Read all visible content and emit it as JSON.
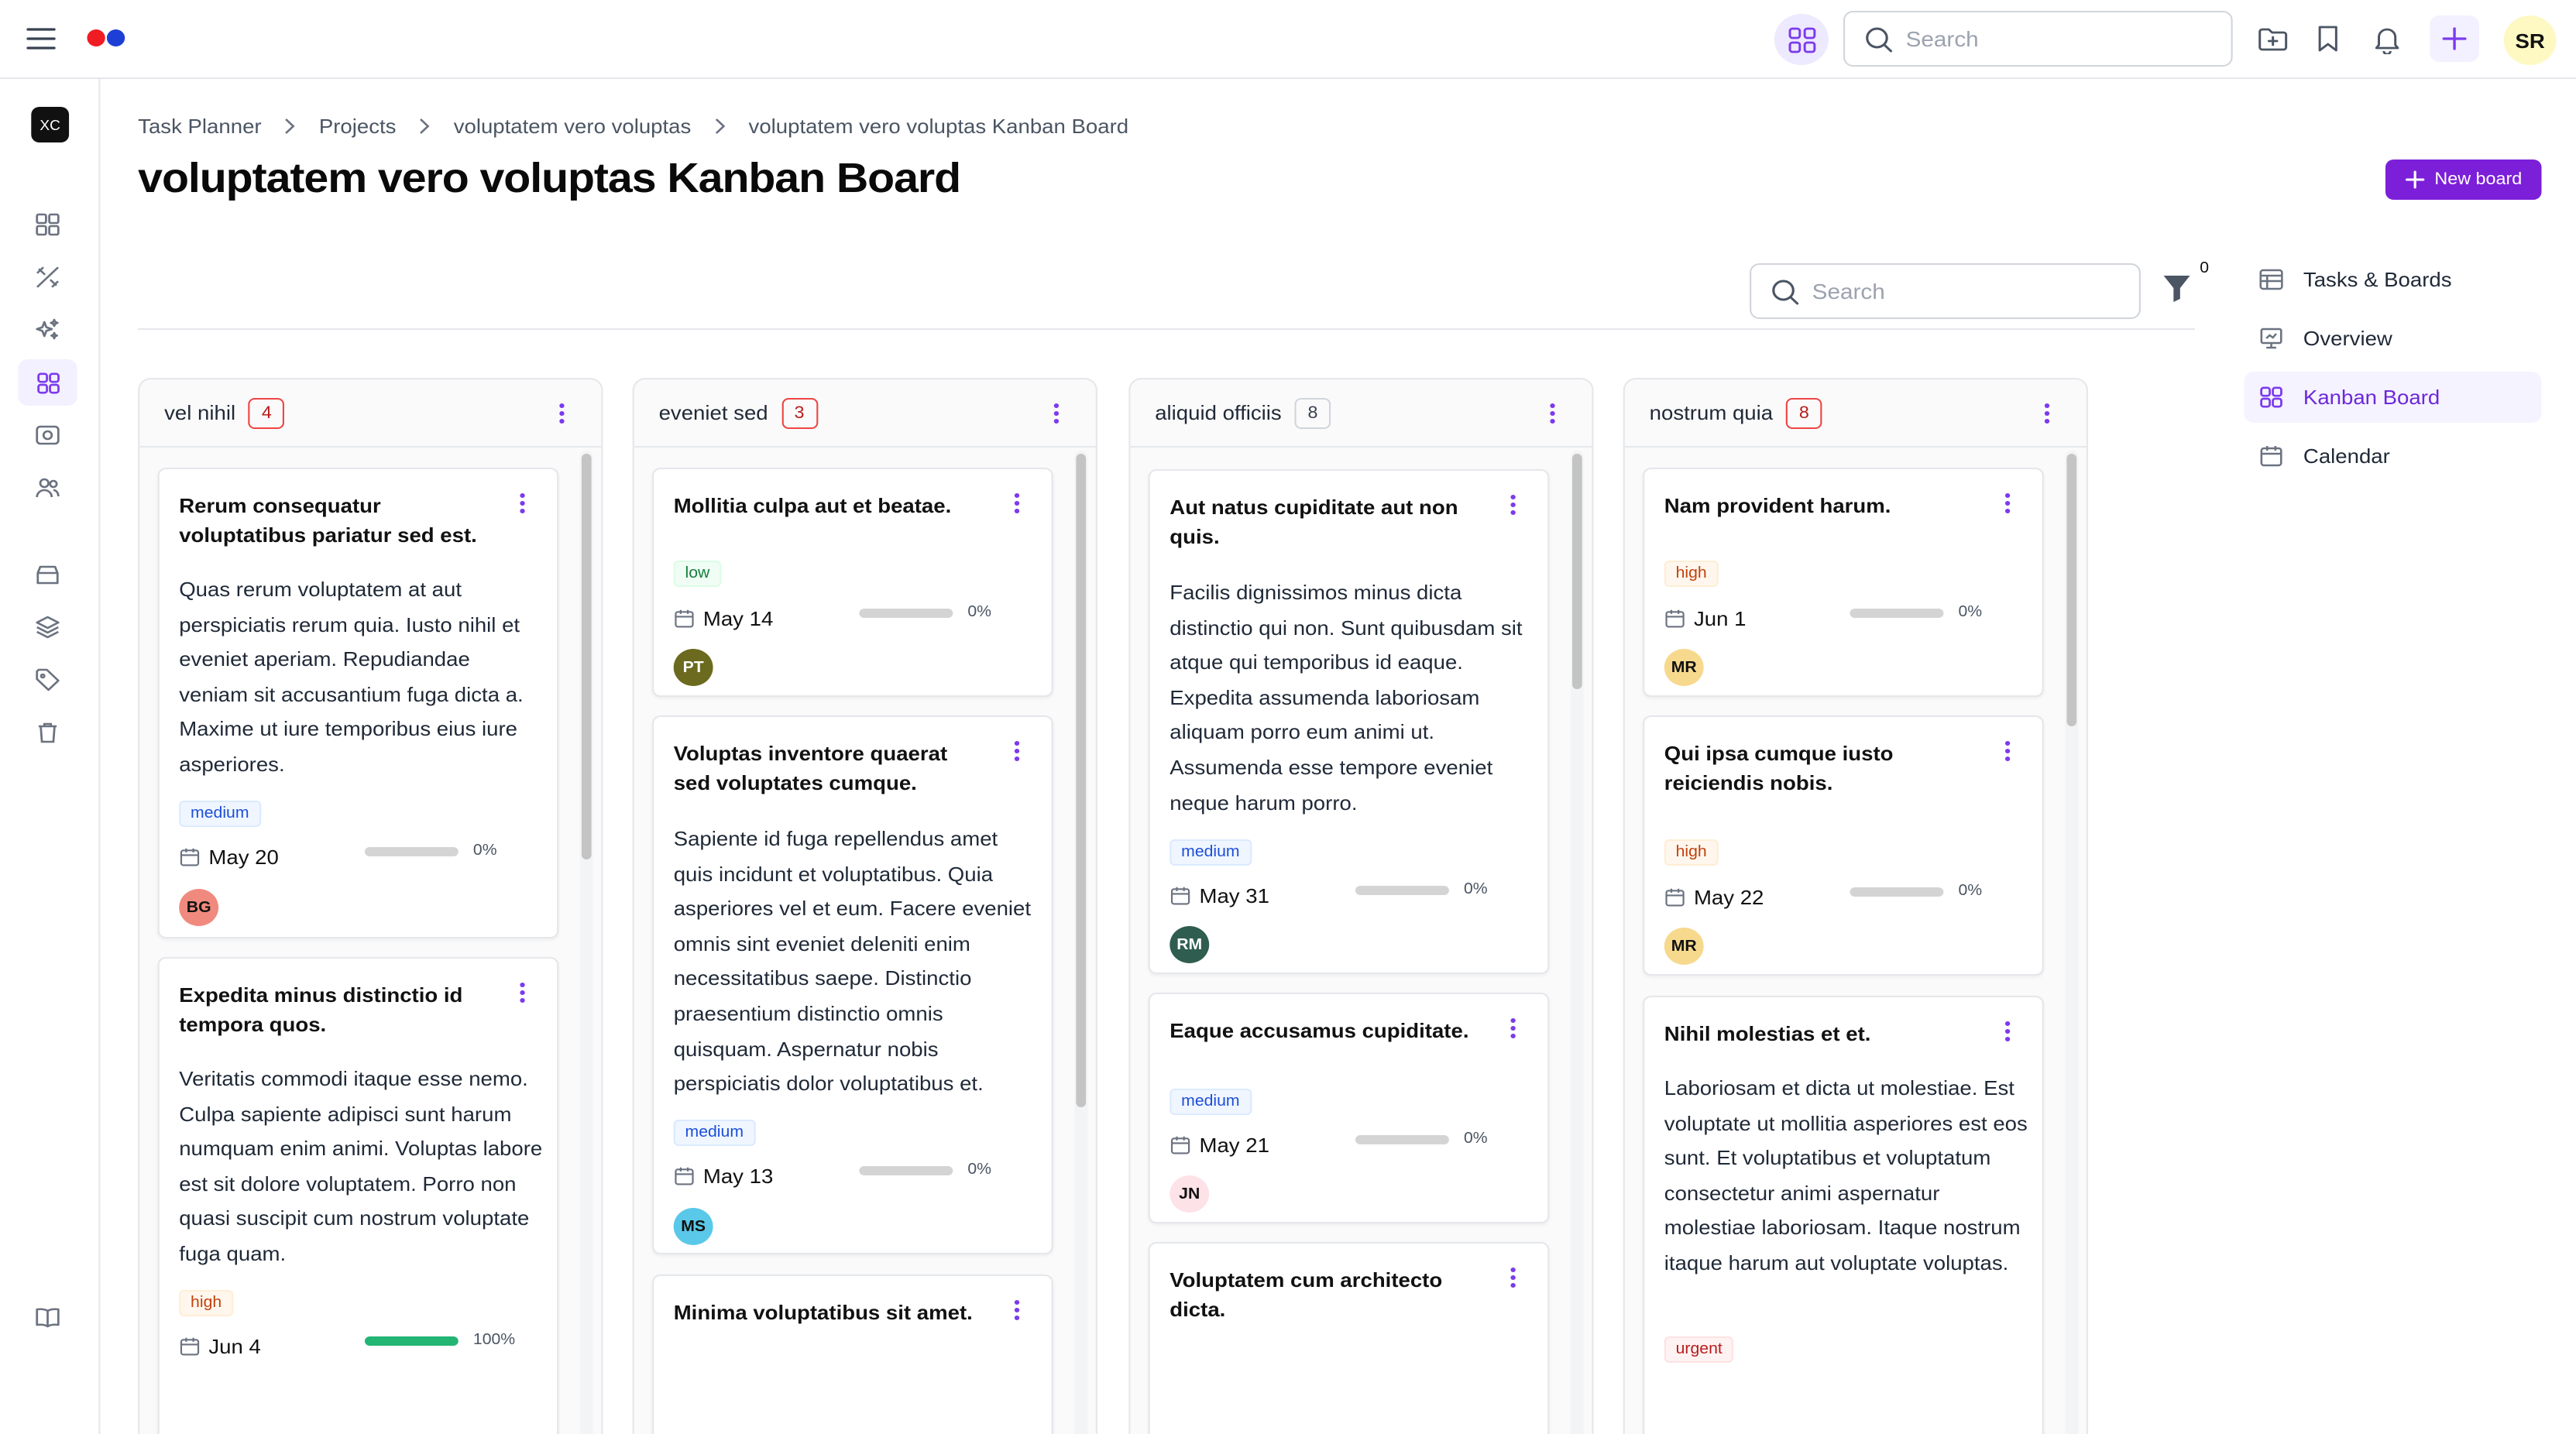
{
  "topbar": {
    "search_placeholder": "Search",
    "user_initials": "SR",
    "colors": {
      "logo_red": "#ef1c24",
      "logo_blue": "#1d3fd6",
      "accent": "#7c1fd9"
    }
  },
  "workspace": {
    "initials": "XC"
  },
  "breadcrumb": [
    "Task Planner",
    "Projects",
    "voluptatem vero voluptas",
    "voluptatem vero voluptas Kanban Board"
  ],
  "page_title": "voluptatem vero voluptas Kanban Board",
  "new_board_label": "New board",
  "board_search_placeholder": "Search",
  "filter_count": "0",
  "right_nav": [
    {
      "label": "Tasks & Boards",
      "icon": "table-icon"
    },
    {
      "label": "Overview",
      "icon": "presentation-icon"
    },
    {
      "label": "Kanban Board",
      "icon": "grid-icon"
    },
    {
      "label": "Calendar",
      "icon": "calendar-icon"
    }
  ],
  "columns": [
    {
      "name": "vel nihil",
      "count": "4",
      "cards": [
        {
          "title": "Rerum consequatur voluptatibus pariatur sed est.",
          "description": "Quas rerum voluptatem at aut perspiciatis rerum quia. Iusto nihil et eveniet aperiam. Repudiandae veniam sit accusantium fuga dicta a. Maxime ut iure temporibus eius iure asperiores.",
          "priority": "medium",
          "due": "May 20",
          "progress": 0,
          "progress_label": "0%",
          "assignee": "BG",
          "assignee_color": "#f08a7e"
        },
        {
          "title": "Expedita minus distinctio id tempora quos.",
          "description": "Veritatis commodi itaque esse nemo. Culpa sapiente adipisci sunt harum numquam enim animi. Voluptas labore est sit dolore voluptatem. Porro non quasi suscipit cum nostrum voluptate fuga quam.",
          "priority": "high",
          "due": "Jun 4",
          "progress": 100,
          "progress_label": "100%",
          "assignee": "",
          "assignee_color": "#d1d5db"
        }
      ]
    },
    {
      "name": "eveniet sed",
      "count": "3",
      "cards": [
        {
          "title": "Mollitia culpa aut et beatae.",
          "description": "",
          "priority": "low",
          "due": "May 14",
          "progress": 0,
          "progress_label": "0%",
          "assignee": "PT",
          "assignee_color": "#6b6a1e"
        },
        {
          "title": "Voluptas inventore quaerat sed voluptates cumque.",
          "description": "Sapiente id fuga repellendus amet quis incidunt et voluptatibus. Quia asperiores vel et eum. Facere eveniet omnis sint eveniet deleniti enim necessitatibus saepe. Distinctio praesentium distinctio omnis quisquam. Aspernatur nobis perspiciatis dolor voluptatibus et.",
          "priority": "medium",
          "due": "May 13",
          "progress": 0,
          "progress_label": "0%",
          "assignee": "MS",
          "assignee_color": "#5ac8e8"
        },
        {
          "title": "Minima voluptatibus sit amet.",
          "description": "",
          "priority": "",
          "due": "",
          "progress": 0,
          "progress_label": "",
          "assignee": "",
          "assignee_color": ""
        }
      ]
    },
    {
      "name": "aliquid officiis",
      "count": "8",
      "cards": [
        {
          "title": "Aut natus cupiditate aut non quis.",
          "description": "Facilis dignissimos minus dicta distinctio qui non. Sunt quibusdam sit atque qui temporibus id eaque. Expedita assumenda laboriosam aliquam porro eum animi ut. Assumenda esse tempore eveniet neque harum porro.",
          "priority": "medium",
          "due": "May 31",
          "progress": 0,
          "progress_label": "0%",
          "assignee": "RM",
          "assignee_color": "#2f5d50"
        },
        {
          "title": "Eaque accusamus cupiditate.",
          "description": "",
          "priority": "medium",
          "due": "May 21",
          "progress": 0,
          "progress_label": "0%",
          "assignee": "JN",
          "assignee_color": "#fde2e7"
        },
        {
          "title": "Voluptatem cum architecto dicta.",
          "description": "",
          "priority": "",
          "due": "",
          "progress": 0,
          "progress_label": "",
          "assignee": "",
          "assignee_color": ""
        }
      ]
    },
    {
      "name": "nostrum quia",
      "count": "8",
      "cards": [
        {
          "title": "Nam provident harum.",
          "description": "",
          "priority": "high",
          "due": "Jun 1",
          "progress": 0,
          "progress_label": "0%",
          "assignee": "MR",
          "assignee_color": "#f7d98e"
        },
        {
          "title": "Qui ipsa cumque iusto reiciendis nobis.",
          "description": "",
          "priority": "high",
          "due": "May 22",
          "progress": 0,
          "progress_label": "0%",
          "assignee": "MR",
          "assignee_color": "#f7d98e"
        },
        {
          "title": "Nihil molestias et et.",
          "description": "Laboriosam et dicta ut molestiae. Est voluptate ut mollitia asperiores est eos sunt. Et voluptatibus et voluptatum consectetur animi aspernatur molestiae laboriosam. Itaque nostrum itaque harum aut voluptate voluptas.",
          "priority": "urgent",
          "due": "",
          "progress": 0,
          "progress_label": "",
          "assignee": "",
          "assignee_color": ""
        }
      ]
    }
  ]
}
